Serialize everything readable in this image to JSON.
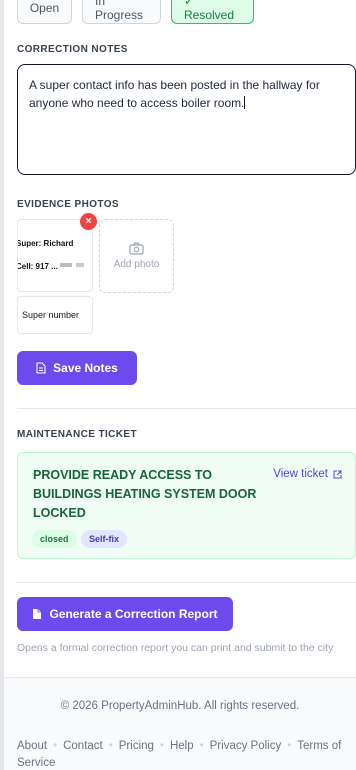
{
  "status": {
    "options": [
      "Open",
      "In Progress",
      "✓ Resolved"
    ],
    "selected": "✓ Resolved"
  },
  "notes": {
    "label": "CORRECTION NOTES",
    "value": "A super contact info has been posted in the hallway for anyone who need to access boiler room."
  },
  "photos": {
    "label": "EVIDENCE PHOTOS",
    "items": [
      {
        "image_text_line1": "Super: Richard",
        "image_text_line2": "Cell: 917 ...",
        "caption": "Super number"
      }
    ],
    "remove_symbol": "×",
    "add_label": "Add photo",
    "add_icon": "camera-icon"
  },
  "save_button": {
    "label": "Save Notes",
    "icon": "document-icon"
  },
  "ticket": {
    "label": "MAINTENANCE TICKET",
    "title": "PROVIDE READY ACCESS TO BUILDINGS HEATING SYSTEM DOOR LOCKED",
    "view_link": "View ticket",
    "view_icon": "external-link-icon",
    "badges": [
      "closed",
      "Self-fix"
    ]
  },
  "report": {
    "button_label": "Generate a Correction Report",
    "icon": "document-icon",
    "note": "Opens a formal correction report you can print and submit to the city"
  },
  "footer": {
    "copyright": "© 2026 PropertyAdminHub. All rights reserved.",
    "links": [
      "About",
      "Contact",
      "Pricing",
      "Help",
      "Privacy Policy",
      "Terms of Service"
    ]
  },
  "colors": {
    "accent": "#6d4aee",
    "resolved_green": "#22c55e",
    "ticket_green": "#166534",
    "danger": "#ef4444"
  }
}
